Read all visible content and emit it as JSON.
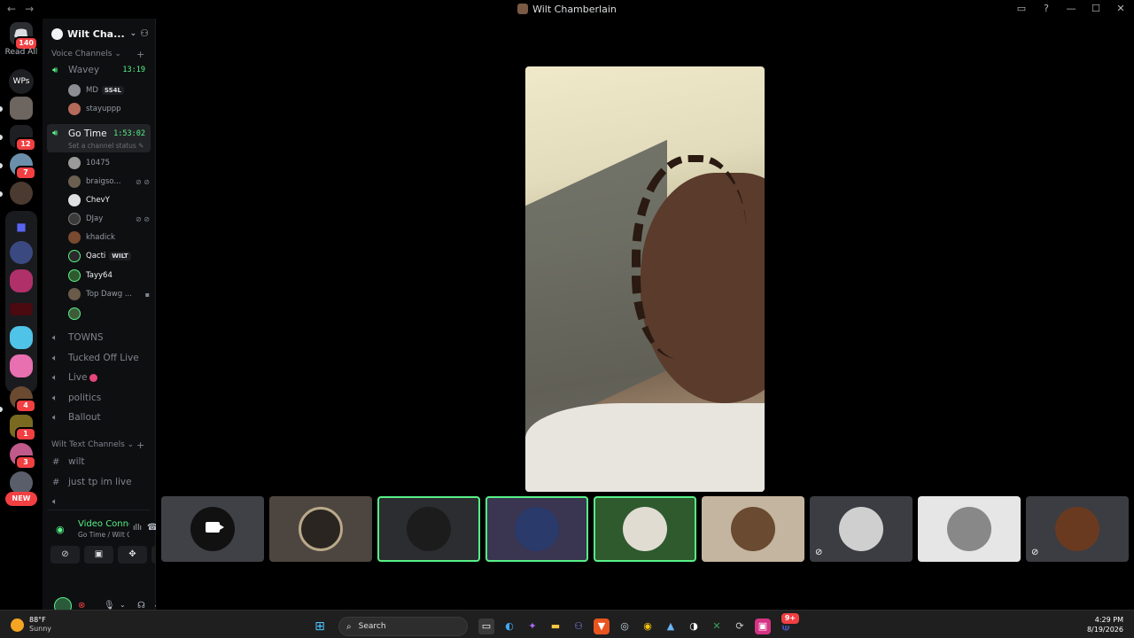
{
  "window": {
    "title": "Wilt Chamberlain",
    "nav_back": "←",
    "nav_forward": "→"
  },
  "rail": {
    "dm_badge": "140",
    "read_all": "Read All",
    "wps_label": "WPs",
    "badges": [
      "12",
      "7",
      "4",
      "1",
      "3"
    ],
    "new_label": "NEW"
  },
  "guild": {
    "name": "Wilt Cha...",
    "voice_category": "Voice Channels",
    "text_category": "Wilt Text Channels"
  },
  "voice_channels": [
    {
      "name": "Wavey",
      "timer": "13:19"
    },
    {
      "name": "Go Time",
      "timer": "1:53:02",
      "status": "Set a channel status"
    },
    {
      "name": "TOWNS"
    },
    {
      "name": "Tucked Off Live"
    },
    {
      "name": "Live"
    },
    {
      "name": "politics"
    },
    {
      "name": "Ballout"
    }
  ],
  "wavey_members": [
    {
      "name": "MD",
      "tag": "SS4L",
      "color": "#8a8d92"
    },
    {
      "name": "stayuppp",
      "color": "#b56a5a"
    }
  ],
  "gotime_members": [
    {
      "name": "10475",
      "icons": "",
      "color": "#9a9a9a"
    },
    {
      "name": "braigso...",
      "icons": "⊘ ⊘",
      "color": "#6b6050"
    },
    {
      "name": "ChevY",
      "icons": "",
      "color": "#e0e0e0"
    },
    {
      "name": "DJay",
      "icons": "⊘ ⊘",
      "color": "#3a3a3a"
    },
    {
      "name": "khadick",
      "icons": "",
      "color": "#7a4a30"
    },
    {
      "name": "Qacti",
      "tag": "WILT",
      "icons": "",
      "color": "#2a2a2a"
    },
    {
      "name": "Tayy64",
      "icons": "",
      "color": "#2e5a2e"
    },
    {
      "name": "Top Dawg ...",
      "icons": "▪",
      "color": "#6a5a4a"
    },
    {
      "name": "",
      "icons": "",
      "color": "#3e5a3a"
    }
  ],
  "text_channels": [
    {
      "name": "wilt"
    },
    {
      "name": "just tp im live"
    },
    {
      "name": ""
    }
  ],
  "voice_panel": {
    "title": "Video Connected",
    "subtitle": "Go Time / Wilt Ch..."
  },
  "taskbar": {
    "temp": "88°F",
    "condition": "Sunny",
    "search_placeholder": "Search",
    "time": "4:29 PM",
    "date": "8/19/2026",
    "discord_badge": "9+"
  },
  "colors": {
    "accent_green": "#57f287",
    "danger": "#f23f42",
    "background": "#000000"
  }
}
